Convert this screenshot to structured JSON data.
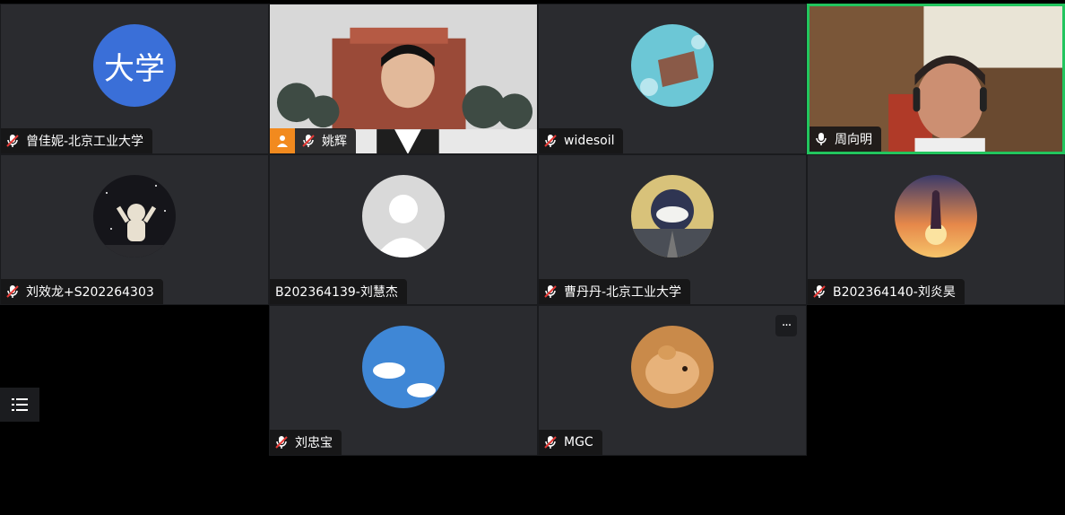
{
  "participants": [
    {
      "name": "曾佳妮-北京工业大学",
      "mic": "muted",
      "avatar_text": "大学"
    },
    {
      "name": "姚辉",
      "mic": "muted",
      "video": true,
      "host": true
    },
    {
      "name": "widesoil",
      "mic": "muted"
    },
    {
      "name": "周向明",
      "mic": "on",
      "video": true,
      "speaking": true
    },
    {
      "name": "刘效龙+S202264303",
      "mic": "muted"
    },
    {
      "name": "B202364139-刘慧杰",
      "mic": "none"
    },
    {
      "name": "曹丹丹-北京工业大学",
      "mic": "muted"
    },
    {
      "name": "B202364140-刘炎昊",
      "mic": "muted"
    },
    {
      "name": "刘忠宝",
      "mic": "muted"
    },
    {
      "name": "MGC",
      "mic": "muted"
    }
  ],
  "more_label": "···",
  "colors": {
    "tile": "#2a2b2f",
    "speaking_border": "#22c55e",
    "host_badge": "#f28a1e",
    "avatar_blue": "#3a6fd8"
  }
}
